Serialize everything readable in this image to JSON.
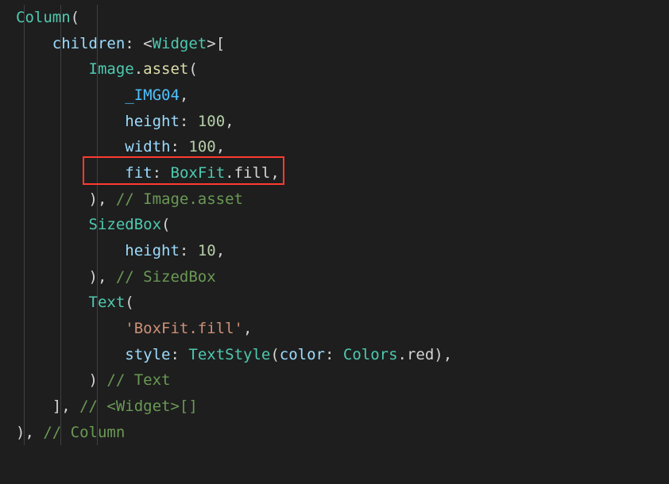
{
  "colors": {
    "bg": "#1e1e1e",
    "type": "#4ec9b0",
    "func": "#dcdcaa",
    "param": "#9cdcfe",
    "num": "#b5cea8",
    "str": "#ce9178",
    "comment": "#6a9955",
    "punct": "#d4d4d4",
    "const": "#4fc1ff",
    "highlight": "#ff3b30"
  },
  "code": {
    "lines": [
      {
        "indent": 0,
        "t": [
          {
            "c": "type",
            "s": "Column"
          },
          {
            "c": "punct",
            "s": "("
          }
        ]
      },
      {
        "indent": 1,
        "t": [
          {
            "c": "param",
            "s": "children"
          },
          {
            "c": "punct",
            "s": ": <"
          },
          {
            "c": "type",
            "s": "Widget"
          },
          {
            "c": "punct",
            "s": ">["
          }
        ]
      },
      {
        "indent": 2,
        "t": [
          {
            "c": "type",
            "s": "Image"
          },
          {
            "c": "punct",
            "s": "."
          },
          {
            "c": "func",
            "s": "asset"
          },
          {
            "c": "punct",
            "s": "("
          }
        ]
      },
      {
        "indent": 3,
        "t": [
          {
            "c": "const",
            "s": "_IMG04"
          },
          {
            "c": "punct",
            "s": ","
          }
        ]
      },
      {
        "indent": 3,
        "t": [
          {
            "c": "param",
            "s": "height"
          },
          {
            "c": "punct",
            "s": ": "
          },
          {
            "c": "num",
            "s": "100"
          },
          {
            "c": "punct",
            "s": ","
          }
        ]
      },
      {
        "indent": 3,
        "t": [
          {
            "c": "param",
            "s": "width"
          },
          {
            "c": "punct",
            "s": ": "
          },
          {
            "c": "num",
            "s": "100"
          },
          {
            "c": "punct",
            "s": ","
          }
        ]
      },
      {
        "indent": 3,
        "t": [
          {
            "c": "param",
            "s": "fit"
          },
          {
            "c": "punct",
            "s": ": "
          },
          {
            "c": "type",
            "s": "BoxFit"
          },
          {
            "c": "punct",
            "s": "."
          },
          {
            "c": "white",
            "s": "fill"
          },
          {
            "c": "punct",
            "s": ","
          }
        ],
        "boxed": true
      },
      {
        "indent": 2,
        "t": [
          {
            "c": "punct",
            "s": "), "
          },
          {
            "c": "comment",
            "s": "// Image.asset"
          }
        ]
      },
      {
        "indent": 2,
        "t": [
          {
            "c": "type",
            "s": "SizedBox"
          },
          {
            "c": "punct",
            "s": "("
          }
        ]
      },
      {
        "indent": 3,
        "t": [
          {
            "c": "param",
            "s": "height"
          },
          {
            "c": "punct",
            "s": ": "
          },
          {
            "c": "num",
            "s": "10"
          },
          {
            "c": "punct",
            "s": ","
          }
        ]
      },
      {
        "indent": 2,
        "t": [
          {
            "c": "punct",
            "s": "), "
          },
          {
            "c": "comment",
            "s": "// SizedBox"
          }
        ]
      },
      {
        "indent": 2,
        "t": [
          {
            "c": "type",
            "s": "Text"
          },
          {
            "c": "punct",
            "s": "("
          }
        ]
      },
      {
        "indent": 3,
        "t": [
          {
            "c": "str",
            "s": "'BoxFit.fill'"
          },
          {
            "c": "punct",
            "s": ","
          }
        ]
      },
      {
        "indent": 3,
        "t": [
          {
            "c": "param",
            "s": "style"
          },
          {
            "c": "punct",
            "s": ": "
          },
          {
            "c": "type",
            "s": "TextStyle"
          },
          {
            "c": "punct",
            "s": "("
          },
          {
            "c": "param",
            "s": "color"
          },
          {
            "c": "punct",
            "s": ": "
          },
          {
            "c": "type",
            "s": "Colors"
          },
          {
            "c": "punct",
            "s": "."
          },
          {
            "c": "white",
            "s": "red"
          },
          {
            "c": "punct",
            "s": "),"
          }
        ]
      },
      {
        "indent": 2,
        "t": [
          {
            "c": "punct",
            "s": ") "
          },
          {
            "c": "comment",
            "s": "// Text"
          }
        ]
      },
      {
        "indent": 1,
        "t": [
          {
            "c": "punct",
            "s": "], "
          },
          {
            "c": "comment",
            "s": "// <Widget>[]"
          }
        ]
      },
      {
        "indent": 0,
        "t": [
          {
            "c": "punct",
            "s": "), "
          },
          {
            "c": "comment",
            "s": "// Column"
          }
        ]
      }
    ]
  },
  "highlight": {
    "lineIndex": 6
  }
}
